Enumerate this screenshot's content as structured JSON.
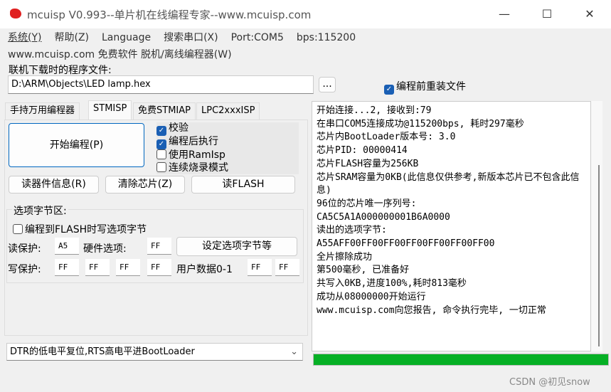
{
  "window": {
    "title": "mcuisp V0.993--单片机在线编程专家--www.mcuisp.com",
    "min": "—",
    "max": "☐",
    "close": "✕"
  },
  "menu": [
    "系统(Y)",
    "帮助(Z)",
    "Language",
    "搜索串口(X)",
    "Port:COM5",
    "bps:115200"
  ],
  "menu2": "www.mcuisp.com 免费软件 脱机/离线编程器(W)",
  "file": {
    "label": "联机下载时的程序文件:",
    "value": "D:\\ARM\\Objects\\LED lamp.hex",
    "browse": "...",
    "reload_label": "编程前重装文件",
    "reload_checked": true
  },
  "tabs": [
    "手持万用编程器",
    "STMISP",
    "免费STMIAP",
    "LPC2xxxISP"
  ],
  "active_tab": "STMISP",
  "start_button": "开始编程(P)",
  "options": [
    {
      "label": "校验",
      "checked": true
    },
    {
      "label": "编程后执行",
      "checked": true
    },
    {
      "label": "使用RamIsp",
      "checked": false
    },
    {
      "label": "连续烧录模式",
      "checked": false
    }
  ],
  "buttons": {
    "read_info": "读器件信息(R)",
    "erase": "清除芯片(Z)",
    "read_flash": "读FLASH",
    "set_option": "设定选项字节等"
  },
  "option_bytes": {
    "title": "选项字节区:",
    "write_on_flash": "编程到FLASH时写选项字节",
    "read_protect_label": "读保护:",
    "read_protect": "A5",
    "hw_label": "硬件选项:",
    "hw": "FF",
    "write_protect_label": "写保护:",
    "write_protect": [
      "FF",
      "FF",
      "FF",
      "FF"
    ],
    "user_label": "用户数据0-1",
    "user": [
      "FF",
      "FF"
    ]
  },
  "boot_mode": "DTR的低电平复位,RTS高电平进BootLoader",
  "log": "开始连接...2, 接收到:79\n在串口COM5连接成功@115200bps, 耗时297毫秒\n芯片内BootLoader版本号: 3.0\n芯片PID: 00000414\n芯片FLASH容量为256KB\n芯片SRAM容量为0KB(此信息仅供参考,新版本芯片已不包含此信息)\n96位的芯片唯一序列号:\nCA5C5A1A000000001B6A0000\n读出的选项字节:\nA55AFF00FF00FF00FF00FF00FF00FF00\n全片擦除成功\n第500毫秒, 已准备好\n共写入0KB,进度100%,耗时813毫秒\n成功从08000000开始运行\nwww.mcuisp.com向您报告, 命令执行完毕, 一切正常",
  "progress": {
    "percent": 100,
    "color": "#06b025"
  },
  "watermark": "CSDN @初见snow"
}
